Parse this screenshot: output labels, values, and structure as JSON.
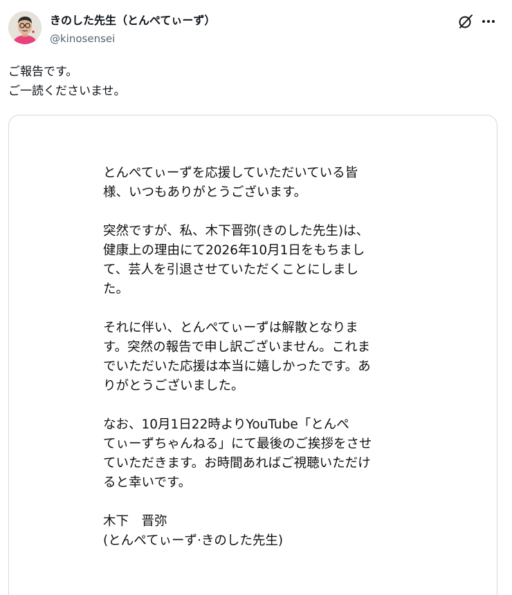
{
  "author": {
    "name": "きのした先生（とんぺてぃーず）",
    "handle": "@kinosensei"
  },
  "icons": {
    "avatar": "avatar-photo",
    "grok": "grok-icon",
    "more": "more-icon"
  },
  "post": {
    "lines": [
      "ご報告です。",
      "ご一読くださいませ。"
    ]
  },
  "letter": {
    "paragraphs": [
      [
        "とんぺてぃーずを応援していただいている皆",
        "様、いつもありがとうございます。"
      ],
      [
        "突然ですが、私、木下晋弥(きのした先生)は、",
        "健康上の理由にて2026年10月1日をもちまし",
        "て、芸人を引退させていただくことにしまし",
        "た。"
      ],
      [
        "それに伴い、とんぺてぃーずは解散となりま",
        "す。突然の報告で申し訳ございません。これま",
        "でいただいた応援は本当に嬉しかったです。あ",
        "りがとうございました。"
      ],
      [
        "なお、10月1日22時よりYouTube「とんぺ",
        "てぃーずちゃんねる」にて最後のご挨拶をさせ",
        "ていただきます。お時間あればご視聴いただけ",
        "ると幸いです。"
      ]
    ],
    "signature": [
      "木下　晋弥",
      "(とんぺてぃーず·きのした先生)"
    ]
  }
}
